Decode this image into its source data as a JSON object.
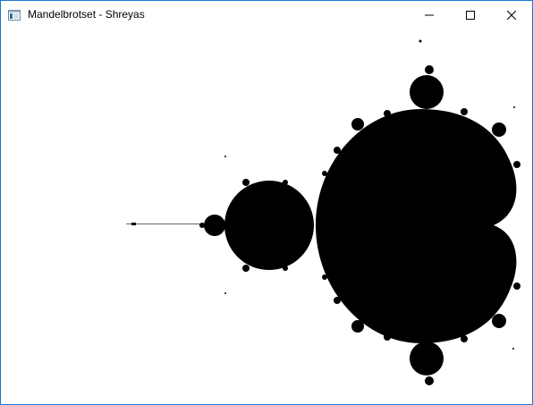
{
  "window": {
    "title": "Mandelbrotset - Shreyas",
    "border_color": "#1979ca"
  },
  "titlebar": {
    "app_icon": "window-app-icon",
    "controls": [
      {
        "name": "minimize-button",
        "icon": "minimize-icon"
      },
      {
        "name": "maximize-button",
        "icon": "maximize-icon"
      },
      {
        "name": "close-button",
        "icon": "close-icon"
      }
    ]
  },
  "canvas": {
    "background_color": "#ffffff",
    "fill_color": "#000000"
  }
}
